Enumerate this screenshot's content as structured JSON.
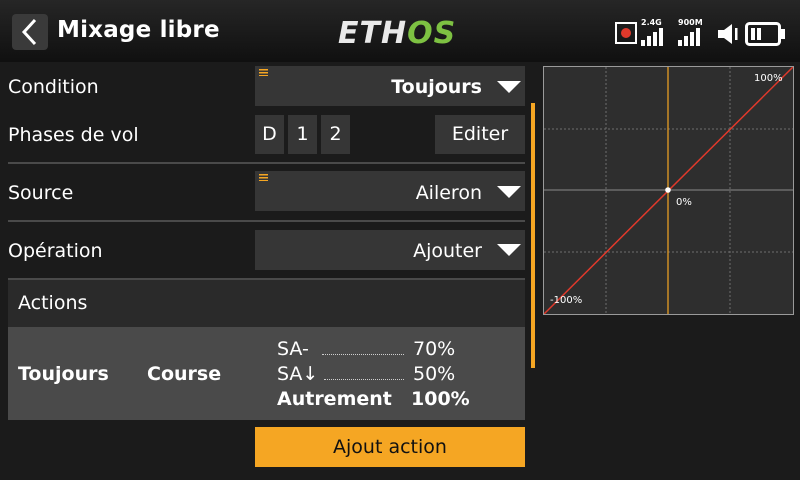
{
  "header": {
    "title": "Mixage libre",
    "logo_part1": "ETH",
    "logo_part2": "OS",
    "signal1_label": "2.4G",
    "signal2_label": "900M"
  },
  "form": {
    "condition": {
      "label": "Condition",
      "value": "Toujours"
    },
    "flight_phases": {
      "label": "Phases de vol",
      "phases": [
        "D",
        "1",
        "2"
      ],
      "edit_label": "Editer"
    },
    "source": {
      "label": "Source",
      "value": "Aileron"
    },
    "operation": {
      "label": "Opération",
      "value": "Ajouter"
    }
  },
  "actions": {
    "title": "Actions",
    "row": {
      "condition": "Toujours",
      "type": "Course",
      "entries": [
        {
          "switch": "SA-",
          "value": "70%"
        },
        {
          "switch": "SA↓",
          "value": "50%"
        }
      ],
      "else_label": "Autrement",
      "else_value": "100%"
    },
    "add_label": "Ajout action"
  },
  "graph": {
    "max_label": "100%",
    "mid_label": "0%",
    "min_label": "-100%"
  },
  "colors": {
    "accent": "#f5a623",
    "curve": "#e0392b",
    "logo_green": "#7dc142"
  }
}
